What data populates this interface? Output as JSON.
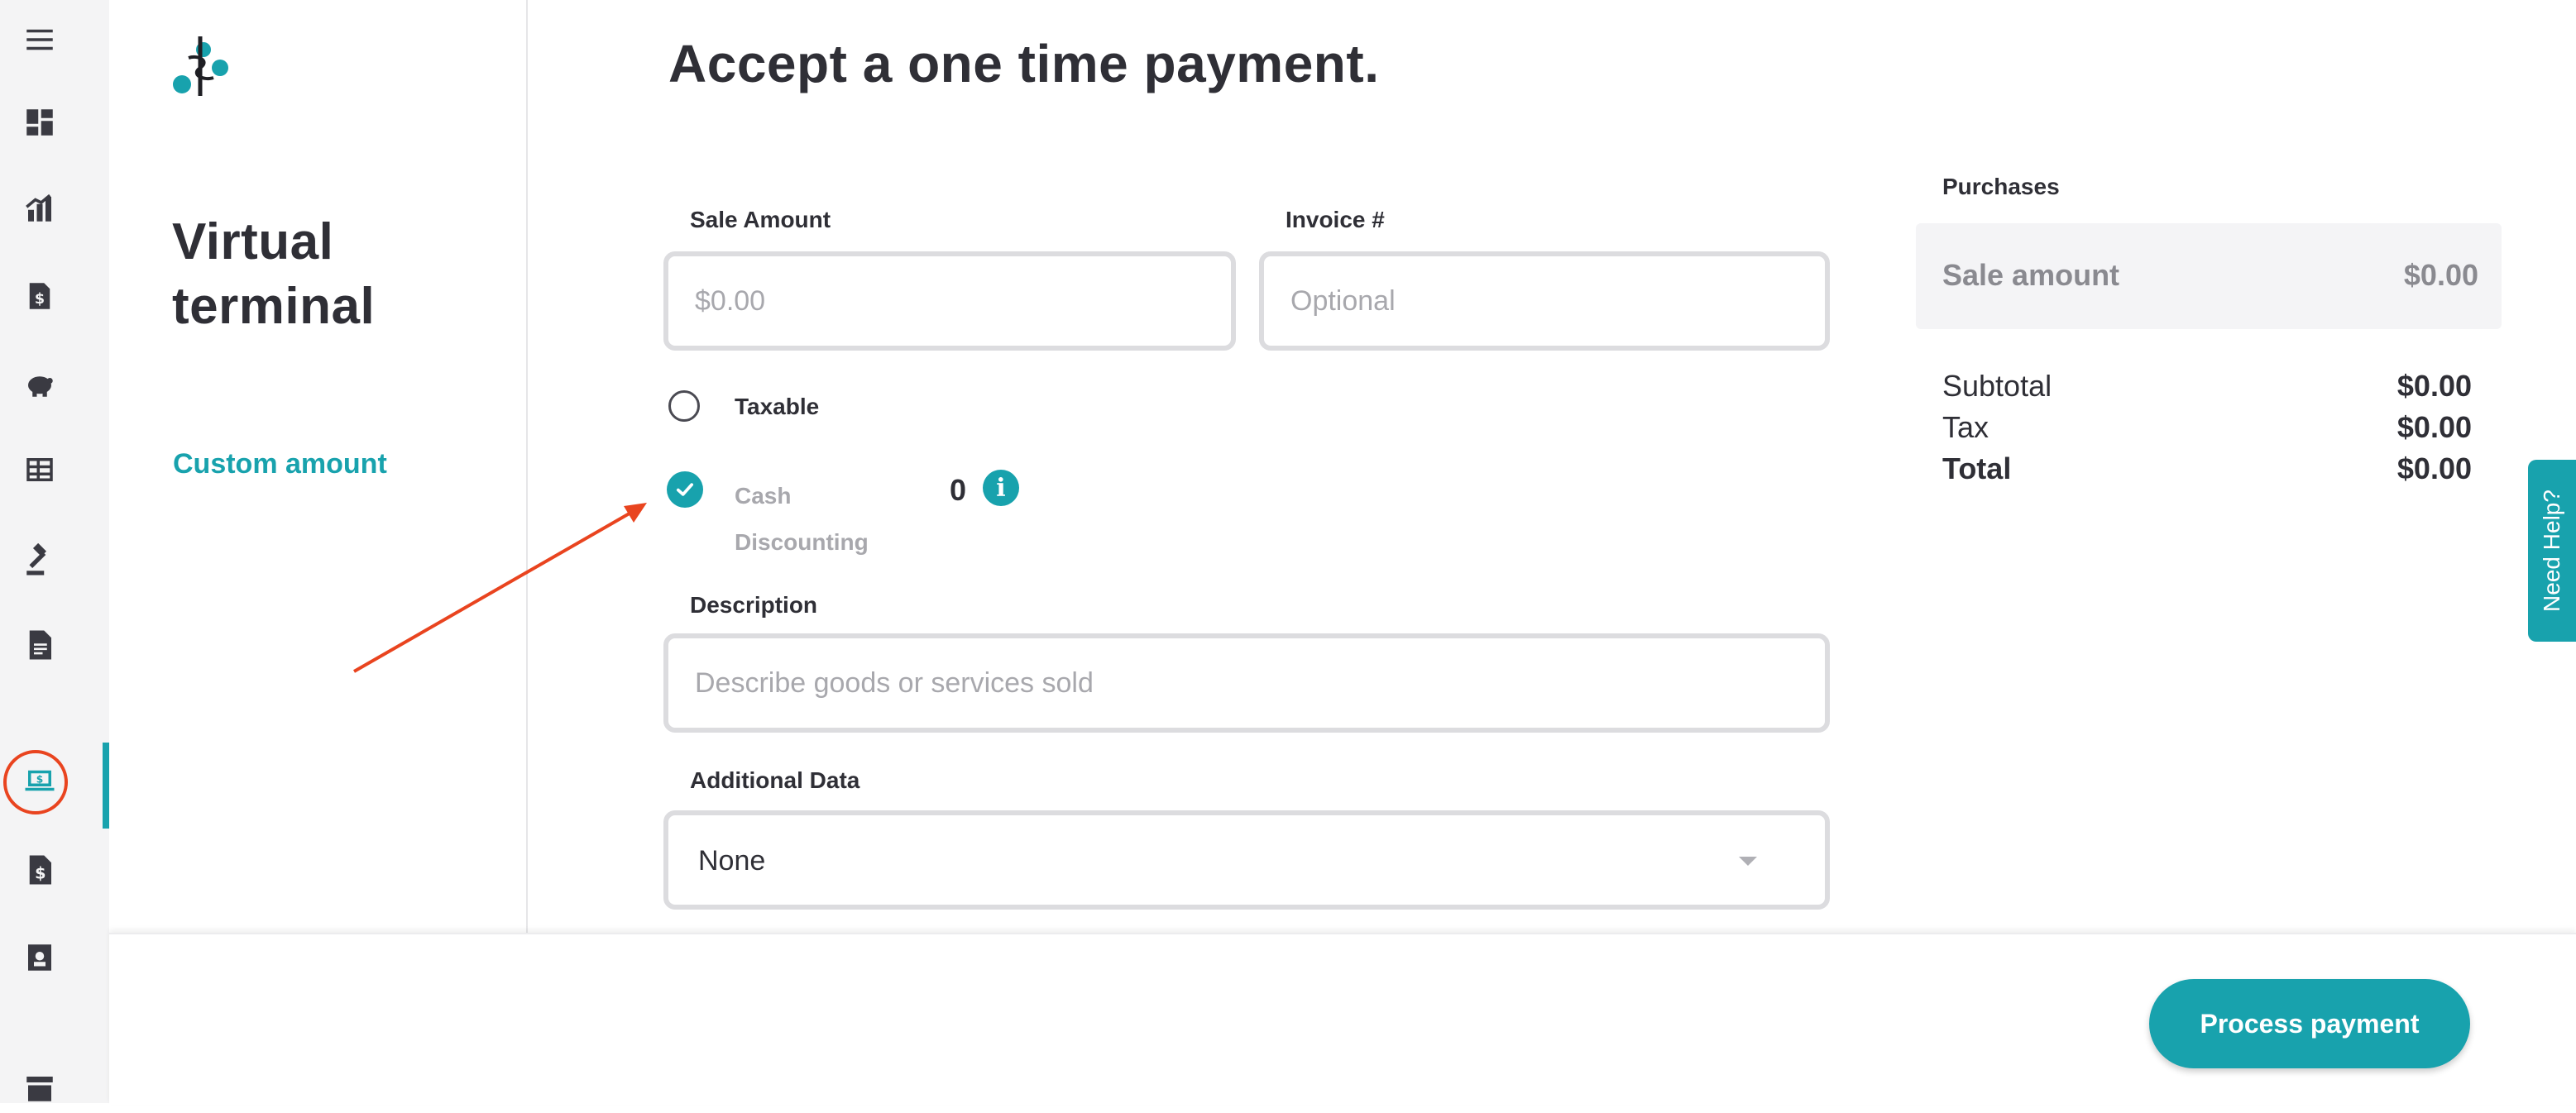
{
  "colors": {
    "accent": "#18a2ad",
    "annotation": "#e9441f",
    "text": "#2f2f36",
    "muted": "#a8a8ad"
  },
  "rail": {
    "items": [
      {
        "icon": "menu-icon"
      },
      {
        "icon": "dashboard-icon"
      },
      {
        "icon": "reports-chart-icon"
      },
      {
        "icon": "dollar-document-icon"
      },
      {
        "icon": "piggy-bank-icon"
      },
      {
        "icon": "table-grid-icon"
      },
      {
        "icon": "gavel-icon"
      },
      {
        "icon": "document-icon"
      },
      {
        "icon": "virtual-terminal-icon",
        "active": true
      },
      {
        "icon": "invoice-dollar-icon"
      },
      {
        "icon": "customer-card-icon"
      },
      {
        "icon": "archive-icon"
      }
    ]
  },
  "left": {
    "heading_line1": "Virtual",
    "heading_line2": "terminal",
    "nav_custom_amount": "Custom amount"
  },
  "form": {
    "title": "Accept a one time payment.",
    "sale_amount_label": "Sale Amount",
    "sale_amount_placeholder": "$0.00",
    "invoice_label": "Invoice #",
    "invoice_placeholder": "Optional",
    "taxable_label": "Taxable",
    "taxable_checked": false,
    "cash_discount_line1": "Cash",
    "cash_discount_line2": "Discounting",
    "cash_discount_checked": true,
    "cash_discount_value": "0",
    "description_label": "Description",
    "description_placeholder": "Describe goods or services sold",
    "additional_data_label": "Additional Data",
    "additional_data_value": "None"
  },
  "purchases": {
    "title": "Purchases",
    "sale_amount_label": "Sale amount",
    "sale_amount_value": "$0.00",
    "subtotal_label": "Subtotal",
    "subtotal_value": "$0.00",
    "tax_label": "Tax",
    "tax_value": "$0.00",
    "total_label": "Total",
    "total_value": "$0.00"
  },
  "help_tab": "Need Help?",
  "footer": {
    "process_button": "Process payment"
  }
}
